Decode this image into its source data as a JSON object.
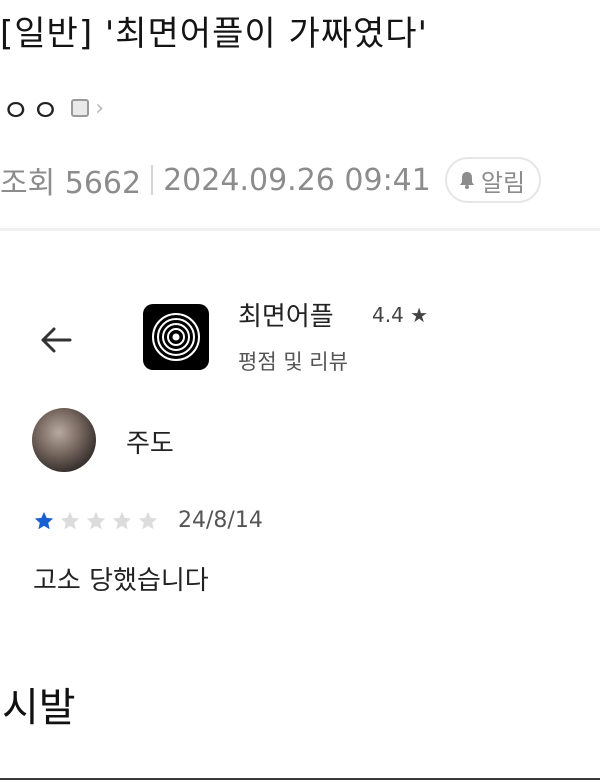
{
  "post": {
    "title": "[일반] '최면어플이 가짜였다'",
    "author": "ㅇㅇ",
    "views_label": "조회 5662",
    "datetime": "2024.09.26 09:41",
    "alarm_label": "알림",
    "body": "시발"
  },
  "screenshot": {
    "app_name": "최면어플",
    "app_rating": "4.4",
    "subtitle": "평점 및 리뷰",
    "review": {
      "reviewer": "주도",
      "rating": 1,
      "max_rating": 5,
      "date": "24/8/14",
      "text": "고소 당했습니다"
    }
  },
  "colors": {
    "star_filled": "#1a5fd0",
    "star_empty": "#dcdcdc"
  },
  "icons": [
    "memo-icon",
    "chevron-right-icon",
    "bell-icon",
    "back-arrow-icon",
    "app-icon",
    "star-icon"
  ]
}
